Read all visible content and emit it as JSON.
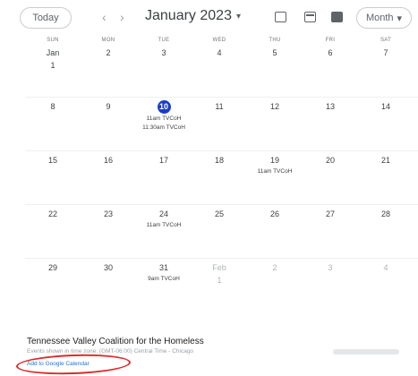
{
  "toolbar": {
    "today_label": "Today",
    "prev_icon": "chevron-left-icon",
    "next_icon": "chevron-right-icon",
    "month_title": "January 2023",
    "caret": "▾",
    "view_select_label": "Month",
    "view_select_caret": "▾"
  },
  "days_of_week": [
    "SUN",
    "MON",
    "TUE",
    "WED",
    "THU",
    "FRI",
    "SAT"
  ],
  "weeks": [
    [
      {
        "day": "Jan 1",
        "dim": false,
        "events": []
      },
      {
        "day": "2",
        "dim": false,
        "events": []
      },
      {
        "day": "3",
        "dim": false,
        "events": []
      },
      {
        "day": "4",
        "dim": false,
        "events": []
      },
      {
        "day": "5",
        "dim": false,
        "events": []
      },
      {
        "day": "6",
        "dim": false,
        "events": []
      },
      {
        "day": "7",
        "dim": false,
        "events": []
      }
    ],
    [
      {
        "day": "8",
        "dim": false,
        "events": []
      },
      {
        "day": "9",
        "dim": false,
        "events": []
      },
      {
        "day": "10",
        "dim": false,
        "today": true,
        "events": [
          "11am TVCoH",
          "11:30am TVCoH"
        ]
      },
      {
        "day": "11",
        "dim": false,
        "events": []
      },
      {
        "day": "12",
        "dim": false,
        "events": []
      },
      {
        "day": "13",
        "dim": false,
        "events": []
      },
      {
        "day": "14",
        "dim": false,
        "events": []
      }
    ],
    [
      {
        "day": "15",
        "dim": false,
        "events": []
      },
      {
        "day": "16",
        "dim": false,
        "events": []
      },
      {
        "day": "17",
        "dim": false,
        "events": []
      },
      {
        "day": "18",
        "dim": false,
        "events": []
      },
      {
        "day": "19",
        "dim": false,
        "events": [
          "11am TVCoH"
        ]
      },
      {
        "day": "20",
        "dim": false,
        "events": []
      },
      {
        "day": "21",
        "dim": false,
        "events": []
      }
    ],
    [
      {
        "day": "22",
        "dim": false,
        "events": []
      },
      {
        "day": "23",
        "dim": false,
        "events": []
      },
      {
        "day": "24",
        "dim": false,
        "events": [
          "11am TVCoH"
        ]
      },
      {
        "day": "25",
        "dim": false,
        "events": []
      },
      {
        "day": "26",
        "dim": false,
        "events": []
      },
      {
        "day": "27",
        "dim": false,
        "events": []
      },
      {
        "day": "28",
        "dim": false,
        "events": []
      }
    ],
    [
      {
        "day": "29",
        "dim": false,
        "events": []
      },
      {
        "day": "30",
        "dim": false,
        "events": []
      },
      {
        "day": "31",
        "dim": false,
        "events": [
          "9am TVCoH"
        ]
      },
      {
        "day": "Feb 1",
        "dim": true,
        "events": []
      },
      {
        "day": "2",
        "dim": true,
        "events": []
      },
      {
        "day": "3",
        "dim": true,
        "events": []
      },
      {
        "day": "4",
        "dim": true,
        "events": []
      }
    ]
  ],
  "footer": {
    "calendar_name": "Tennessee Valley Coalition for the Homeless",
    "timezone": "Events shown in time zone: (GMT-06:00) Central Time - Chicago",
    "add_link": "Add to Google Calendar"
  },
  "colors": {
    "accent": "#1a3cc8",
    "link": "#1a73e8",
    "annotation": "#e0292b"
  }
}
